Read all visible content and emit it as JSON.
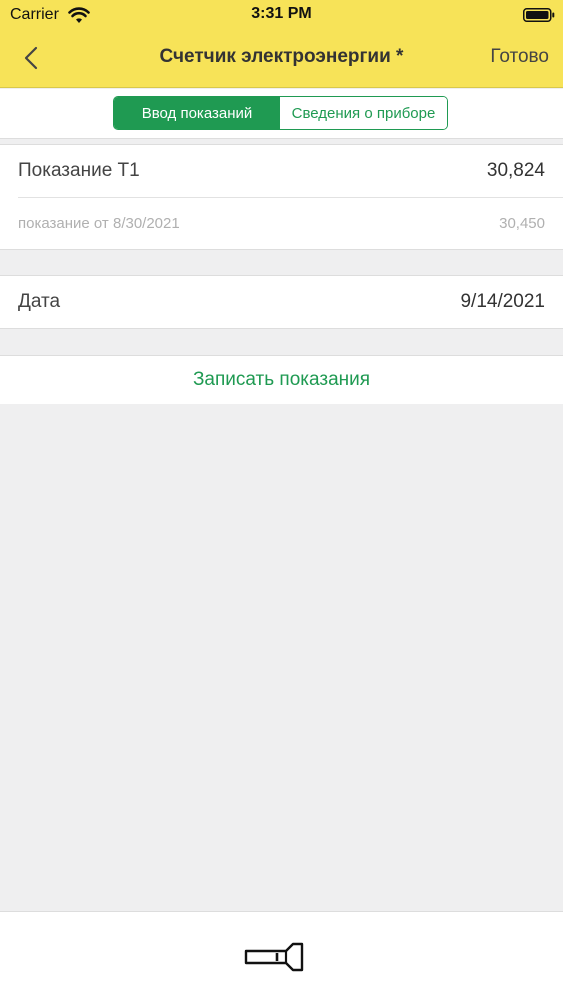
{
  "status_bar": {
    "carrier": "Carrier",
    "time": "3:31 PM"
  },
  "nav": {
    "title": "Счетчик электроэнергии *",
    "done_label": "Готово"
  },
  "segments": {
    "active": "Ввод показаний",
    "inactive": "Сведения о приборе"
  },
  "reading": {
    "label": "Показание Т1",
    "value": "30,824",
    "previous_label": "показание от 8/30/2021",
    "previous_value": "30,450"
  },
  "date": {
    "label": "Дата",
    "value": "9/14/2021"
  },
  "action": {
    "save_label": "Записать показания"
  },
  "icons": {
    "back": "chevron-left-icon",
    "wifi": "wifi-icon",
    "battery": "battery-icon",
    "flashlight": "flashlight-icon"
  },
  "colors": {
    "header": "#f7e358",
    "accent": "#1f9a52"
  }
}
